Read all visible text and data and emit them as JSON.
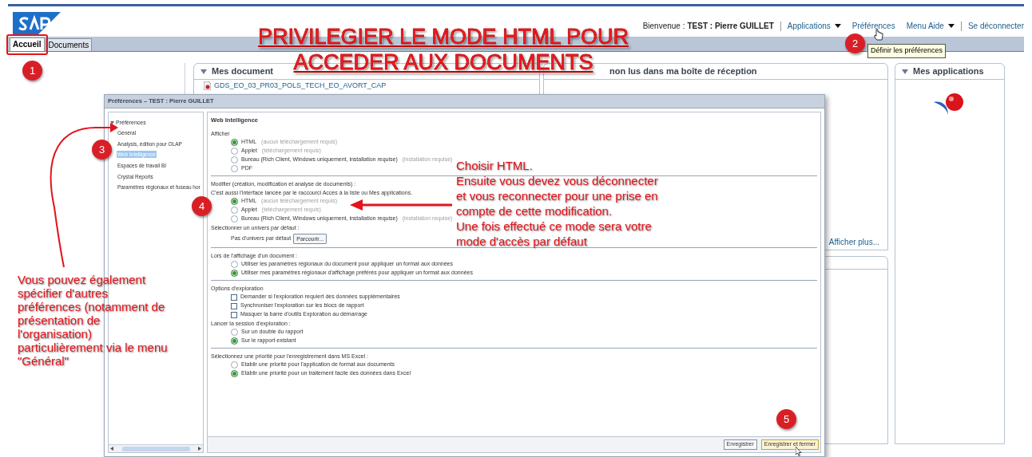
{
  "header": {
    "welcome_label": "Bienvenue :",
    "user": "TEST : Pierre GUILLET",
    "menu": [
      {
        "label": "Applications",
        "dropdown": true
      },
      {
        "label": "Préférences",
        "dropdown": false
      },
      {
        "label": "Menu Aide",
        "dropdown": true
      },
      {
        "label": "Se déconnecter",
        "dropdown": false
      }
    ],
    "tooltip": "Définir les préférences"
  },
  "tabs": [
    {
      "label": "Accueil",
      "selected": true
    },
    {
      "label": "Documents",
      "selected": false
    }
  ],
  "panels": [
    {
      "title": "Mes document",
      "items": [
        "GDS_EO_03_PR03_POLS_TECH_EO_AVORT_CAP"
      ]
    },
    {
      "title": "non lus dans ma boîte de réception",
      "link": "Afficher plus..."
    },
    {
      "title": "Mes applications"
    }
  ],
  "dialog": {
    "title": "Préférences – TEST : Pierre GUILLET",
    "tree": {
      "label": "Préférences",
      "expanded": true,
      "children": [
        {
          "label": "Général",
          "selected": false
        },
        {
          "label": "Analysis, édition pour OLAP",
          "selected": false
        },
        {
          "label": "Web Intelligence",
          "selected": true
        },
        {
          "label": "Espaces de travail BI",
          "selected": false
        },
        {
          "label": "Crystal Reports",
          "selected": false
        },
        {
          "label": "Paramètres régionaux et fuseau hor",
          "selected": false
        }
      ]
    },
    "heading": "Web Intelligence",
    "sections": [
      [
        {
          "kind": "text",
          "label": "Afficher"
        },
        {
          "kind": "radio",
          "label": "HTML",
          "hint": "(aucun téléchargement requis)",
          "selected": true
        },
        {
          "kind": "radio",
          "label": "Applet",
          "hint": "(téléchargement requis)",
          "selected": false
        },
        {
          "kind": "radio",
          "label": "Bureau (Rich Client, Windows uniquement, installation requise)",
          "hint": "(installation requise)",
          "selected": false
        },
        {
          "kind": "radio",
          "label": "PDF",
          "selected": false
        }
      ],
      [
        {
          "kind": "text",
          "label": "Modifier (création, modification et analyse de documents) :"
        },
        {
          "kind": "text",
          "label": "C'est aussi l'interface lancée par le raccourci Accès à la liste ou Mes applications."
        },
        {
          "kind": "radio",
          "label": "HTML",
          "hint": "(aucun téléchargement requis)",
          "selected": true
        },
        {
          "kind": "radio",
          "label": "Applet",
          "hint": "(téléchargement requis)",
          "selected": false
        },
        {
          "kind": "radio",
          "label": "Bureau (Rich Client, Windows uniquement, installation requise)",
          "hint": "(installation requise)",
          "selected": false
        },
        {
          "kind": "text",
          "label": "Sélectionner un univers par défaut :"
        },
        {
          "kind": "browse",
          "label": "Pas d'univers par défaut",
          "button": "Parcourir..."
        }
      ],
      [
        {
          "kind": "text",
          "label": "Lors de l'affichage d'un document :"
        },
        {
          "kind": "radio",
          "label": "Utiliser les paramètres régionaux du document pour appliquer un format aux données",
          "selected": false
        },
        {
          "kind": "radio",
          "label": "Utiliser mes paramètres régionaux d'affichage préférés pour appliquer un format aux données",
          "selected": true
        }
      ],
      [
        {
          "kind": "text",
          "label": "Options d'exploration"
        },
        {
          "kind": "checkbox",
          "label": "Demander si l'exploration requiert des données supplémentaires",
          "checked": false
        },
        {
          "kind": "checkbox",
          "label": "Synchroniser l'exploration sur les blocs de rapport",
          "checked": false
        },
        {
          "kind": "checkbox",
          "label": "Masquer la barre d'outils Exploration au démarrage",
          "checked": false
        },
        {
          "kind": "text",
          "label": "Lancer la session d'exploration :"
        },
        {
          "kind": "radio",
          "label": "Sur un double du rapport",
          "selected": false
        },
        {
          "kind": "radio",
          "label": "Sur le rapport existant",
          "selected": true
        }
      ],
      [
        {
          "kind": "text",
          "label": "Sélectionnez une priorité pour l'enregistrement dans MS Excel :"
        },
        {
          "kind": "radio",
          "label": "Etablir une priorité pour l'application de format aux documents",
          "selected": false
        },
        {
          "kind": "radio",
          "label": "Etablir une priorité pour un traitement facile des données dans Excel",
          "selected": true
        }
      ]
    ],
    "buttons": [
      {
        "label": "Enregistrer",
        "highlighted": false
      },
      {
        "label": "Enregistrer et fermer",
        "highlighted": true
      }
    ]
  },
  "annotations": {
    "title": [
      "PRIVILEGIER LE MODE HTML POUR",
      "ACCEDER AUX DOCUMENTS"
    ],
    "badges": [
      "1",
      "2",
      "3",
      "4",
      "5"
    ],
    "note_right": [
      "Choisir HTML.",
      "Ensuite vous devez vous déconnecter",
      "et vous reconnecter pour une prise en",
      "compte de cette modification.",
      "Une fois effectué ce mode sera votre",
      "mode d'accès par défaut"
    ],
    "note_left": [
      "Vous pouvez également",
      "spécifier d'autres",
      "préférences (notamment de",
      "présentation de",
      "l'organisation)",
      "particulièrement via le menu",
      "\"Général\""
    ]
  }
}
